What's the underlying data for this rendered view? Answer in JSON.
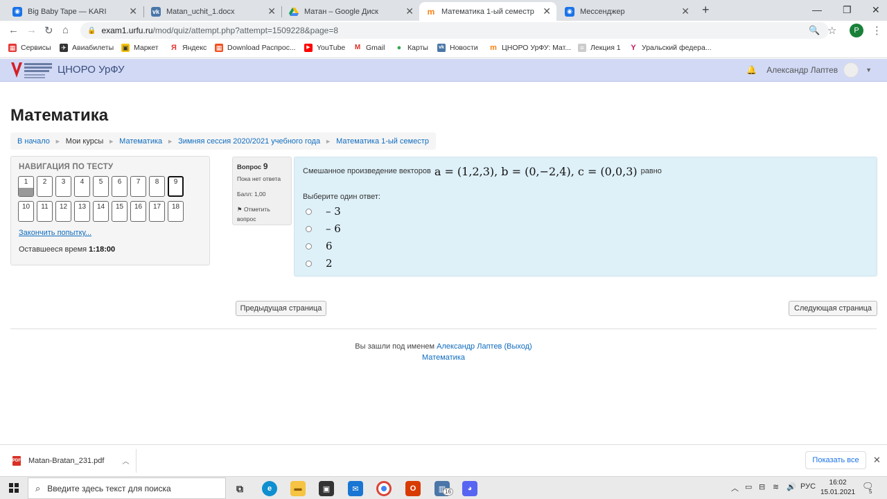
{
  "browser": {
    "tabs": [
      {
        "label": "Big Baby Tape — KARI",
        "icon": "messenger-icon"
      },
      {
        "label": "Matan_uchit_1.docx",
        "icon": "vk-icon"
      },
      {
        "label": "Матан – Google Диск",
        "icon": "google-drive-icon"
      },
      {
        "label": "Математика 1-ый семестр",
        "icon": "moodle-icon"
      },
      {
        "label": "Мессенджер",
        "icon": "messenger-icon"
      }
    ],
    "url_host": "exam1.urfu.ru",
    "url_path": "/mod/quiz/attempt.php?attempt=1509228&page=8",
    "profile_initial": "P",
    "bookmarks": [
      "Сервисы",
      "Авиабилеты",
      "Маркет",
      "Яндекс",
      "Download Распрос...",
      "YouTube",
      "Gmail",
      "Карты",
      "Новости",
      "ЦНОРО УрФУ: Мат...",
      "Лекция 1",
      "Уральский федера..."
    ]
  },
  "site": {
    "title": "ЦНОРО УрФУ",
    "user_name": "Александр Лаптев"
  },
  "page": {
    "heading": "Математика",
    "breadcrumb": [
      "В начало",
      "Мои курсы",
      "Математика",
      "Зимняя сессия 2020/2021 учебного года",
      "Математика 1-ый семестр"
    ]
  },
  "quiz_nav": {
    "heading": "НАВИГАЦИЯ ПО ТЕСТУ",
    "questions": [
      "1",
      "2",
      "3",
      "4",
      "5",
      "6",
      "7",
      "8",
      "9",
      "10",
      "11",
      "12",
      "13",
      "14",
      "15",
      "16",
      "17",
      "18"
    ],
    "answered": [
      "1"
    ],
    "current": "9",
    "finish_link": "Закончить попытку...",
    "time_label": "Оставшееся время",
    "time_value": "1:18:00"
  },
  "question": {
    "label": "Вопрос",
    "number": "9",
    "status": "Пока нет ответа",
    "grade": "Балл: 1,00",
    "flag": "Отметить вопрос",
    "text_before": "Смешанное произведение векторов",
    "formula": "a = (1,2,3), b = (0,−2,4), c = (0,0,3)",
    "text_after": "равно",
    "prompt": "Выберите один ответ:",
    "options": [
      "– 3",
      "– 6",
      "6",
      "2"
    ]
  },
  "buttons": {
    "prev": "Предыдущая страница",
    "next": "Следующая страница"
  },
  "footer": {
    "logged_in_prefix": "Вы зашли под именем",
    "user": "Александр Лаптев",
    "logout": "(Выход)",
    "course_link": "Математика"
  },
  "downloads": {
    "file": "Matan-Bratan_231.pdf",
    "show_all": "Показать все"
  },
  "taskbar": {
    "search_placeholder": "Введите здесь текст для поиска",
    "lang": "РУС",
    "time": "16:02",
    "date": "15.01.2021",
    "notifications": "5",
    "badge_count": "16"
  }
}
